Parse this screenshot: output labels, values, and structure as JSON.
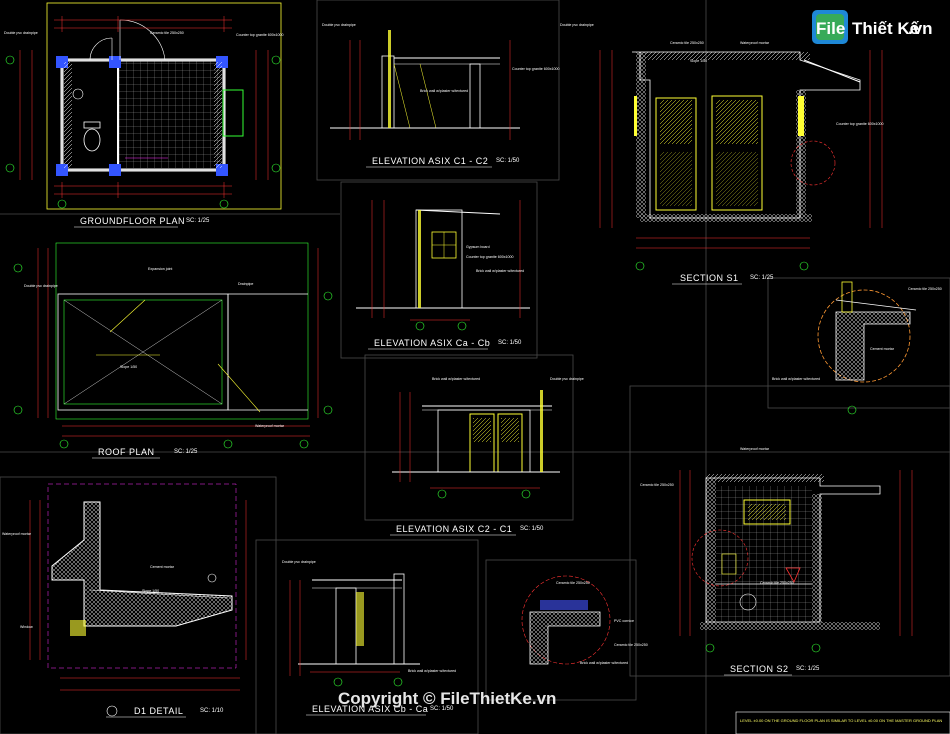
{
  "colors": {
    "background": "#000000",
    "wall": "#ffffff",
    "dimension": "#ff3333",
    "yellow": "#ffff33",
    "green": "#33ff33",
    "cyan": "#33ffff",
    "magenta": "#ff33ff",
    "frame": "#555555",
    "logo_blue": "#1e88d6",
    "logo_green": "#3cb043"
  },
  "logo": {
    "text_1": "File",
    "text_2": "Thiết Kế",
    "text_3": ".vn"
  },
  "watermark": "Copyright © FileThietKe.vn",
  "drawings": {
    "groundfloor_plan": {
      "title": "GROUNDFLOOR PLAN",
      "scale": "SC: 1/25"
    },
    "elevation_c1_c2": {
      "title": "ELEVATION ASIX C1 - C2",
      "scale": "SC: 1/50"
    },
    "section_s1": {
      "title": "SECTION S1",
      "scale": "SC: 1/25"
    },
    "roof_plan": {
      "title": "ROOF PLAN",
      "scale": "SC: 1/25"
    },
    "elevation_ca_cb": {
      "title": "ELEVATION ASIX Ca - Cb",
      "scale": "SC: 1/50"
    },
    "elevation_c2_c1": {
      "title": "ELEVATION ASIX C2 - C1",
      "scale": "SC: 1/50"
    },
    "d1_detail": {
      "title": "D1 DETAIL",
      "scale": "SC: 1/10"
    },
    "elevation_cb_ca": {
      "title": "ELEVATION ASIX Cb - Ca",
      "scale": "SC: 1/50"
    },
    "section_s2": {
      "title": "SECTION S2",
      "scale": "SC: 1/25"
    }
  },
  "notes": {
    "double_pvc": "Double pvc drainpipe",
    "ceramic_tile": "Ceramic tile 250x250",
    "counter_top": "Counter top granite 600x1000",
    "brick_wall": "Brick wall w/plaster w/textured",
    "waterproof_mortar": "Waterproof mortar",
    "slope": "Slope 1/50",
    "expansion_joint": "Expansion joint",
    "drainpipe": "Drainpipe",
    "gypsum_board": "Gypsum board",
    "pvc_cornice": "PVC cornice",
    "cement_mortar": "Cement mortar",
    "window": "Window",
    "d1_label": "D1"
  },
  "footer_text": "LEVEL ±0.00 ON THE GROUND FLOOR PLAN IS SIMILAR TO LEVEL ±0.00 ON THE MASTER GROUND PLAN"
}
